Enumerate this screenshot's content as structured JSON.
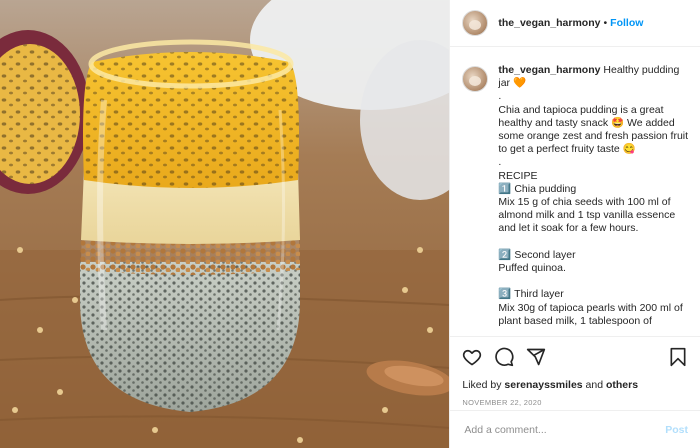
{
  "post": {
    "username": "the_vegan_harmony",
    "follow_label": "Follow",
    "separator": "•"
  },
  "caption": {
    "username": "the_vegan_harmony",
    "text_line_1": " Healthy pudding jar 🧡",
    "text_rest": ".\nChia and tapioca pudding is a great healthy and tasty snack 🤩 We added some orange zest and fresh passion fruit to get a perfect fruity taste 😋\n.\nRECIPE\n1️⃣ Chia pudding\nMix 15 g of chia seeds with 100 ml of almond milk and 1 tsp vanilla essence and let it soak for a few hours.\n\n2️⃣ Second layer\nPuffed quinoa.\n\n3️⃣ Third layer\nMix 30g of tapioca pearls with 200 ml of plant based milk, 1 tablespoon of"
  },
  "actions": {
    "liked_by_prefix": "Liked by ",
    "liked_by_user": "serenayssmiles",
    "liked_by_middle": " and ",
    "liked_by_others": "others",
    "date": "NOVEMBER 22, 2020"
  },
  "comment": {
    "placeholder": "Add a comment...",
    "post_label": "Post"
  },
  "icons": {
    "like": "heart-icon",
    "comment": "comment-icon",
    "share": "share-icon",
    "save": "bookmark-icon"
  },
  "colors": {
    "accent": "#0095f6",
    "post_disabled": "#b2dffc",
    "text": "#262626",
    "muted": "#8e8e8e"
  }
}
